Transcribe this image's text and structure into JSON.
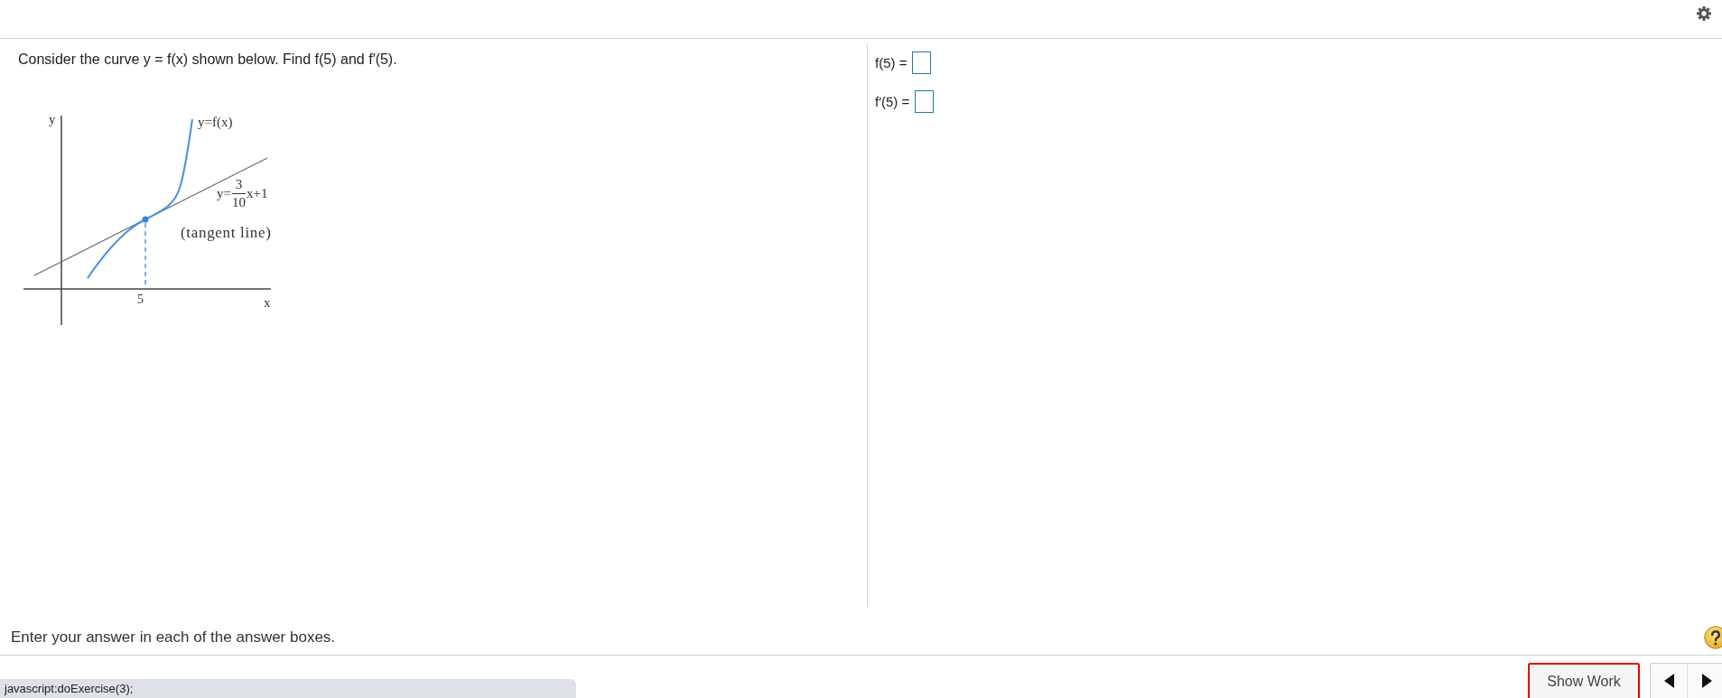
{
  "question": "Consider the curve y = f(x) shown below. Find f(5) and f′(5).",
  "figure": {
    "y_axis_label": "y",
    "x_axis_label": "x",
    "x_tick": "5",
    "curve_label": "y=f(x)",
    "tangent_equation": {
      "lhs": "y=",
      "numerator": "3",
      "denominator": "10",
      "rest": "x+1"
    },
    "tangent_note": "(tangent line)"
  },
  "answers": [
    {
      "label": "f(5) ="
    },
    {
      "label": "f′(5) ="
    }
  ],
  "instruction": "Enter your answer in each of the answer boxes.",
  "actions": {
    "show_work": {
      "label": "Show Work",
      "highlighted": true
    }
  },
  "status_bar": "javascript:doExercise(3);"
}
